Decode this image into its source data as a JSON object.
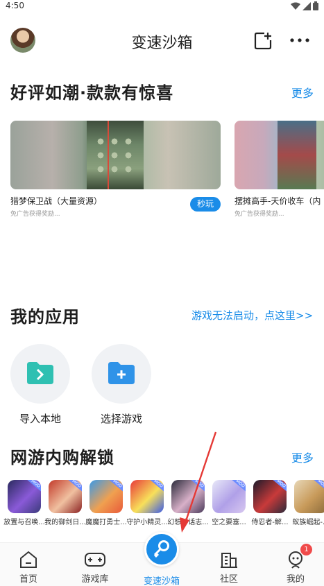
{
  "status_bar": {
    "time": "4:50"
  },
  "header": {
    "title": "变速沙箱"
  },
  "featured": {
    "title": "好评如潮·款款有惊喜",
    "more_label": "更多",
    "cards": [
      {
        "title": "猎梦保卫战（大量资源）",
        "subtitle": "免广告获得奖励...",
        "action_label": "秒玩"
      },
      {
        "title": "摆摊高手-天价收车（内",
        "subtitle": "免广告获得奖励..."
      }
    ]
  },
  "my_apps": {
    "title": "我的应用",
    "help_link": "游戏无法启动，点这里>>",
    "items": [
      {
        "label": "导入本地"
      },
      {
        "label": "选择游戏"
      }
    ]
  },
  "unlock": {
    "title": "网游内购解锁",
    "more_label": "更多",
    "games": [
      {
        "label": "放置与召唤..."
      },
      {
        "label": "我的御剑日..."
      },
      {
        "label": "魔魔打勇士..."
      },
      {
        "label": "守护小精灵..."
      },
      {
        "label": "幻想神话志..."
      },
      {
        "label": "空之要塞..."
      },
      {
        "label": "侍忍者-解..."
      },
      {
        "label": "蚁族崛起-..."
      }
    ],
    "mod_label": "MOD"
  },
  "bottom_nav": {
    "items": [
      {
        "label": "首页"
      },
      {
        "label": "游戏库"
      },
      {
        "label": "变速沙箱"
      },
      {
        "label": "社区"
      },
      {
        "label": "我的"
      }
    ],
    "notification_count": "1"
  },
  "colors": {
    "accent": "#1a8ce8",
    "badge": "#f04a4a",
    "annotation_arrow": "#e53935"
  }
}
